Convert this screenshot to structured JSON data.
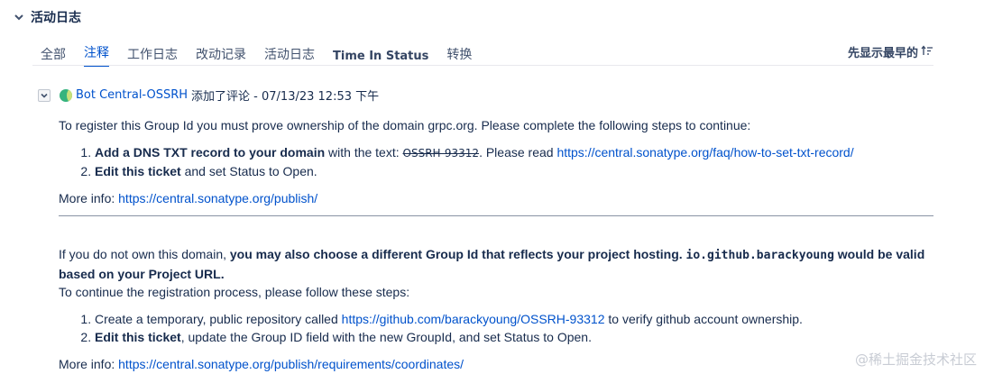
{
  "section": {
    "title": "活动日志"
  },
  "tabs": [
    "全部",
    "注释",
    "工作日志",
    "改动记录",
    "活动日志",
    "Time In Status",
    "转换"
  ],
  "active_tab": "注释",
  "sort_label": "先显示最早的",
  "comment": {
    "author": "Bot Central-OSSRH",
    "meta": "添加了评论 - 07/13/23 12:53 下午",
    "intro": "To register this Group Id you must prove ownership of the domain grpc.org. Please complete the following steps to continue:",
    "step1_bold": "Add a DNS TXT record to your domain",
    "step1_text": " with the text: ",
    "step1_code": "OSSRH-93312",
    "step1_after": ". Please read ",
    "step1_link": "https://central.sonatype.org/faq/how-to-set-txt-record/",
    "step2_bold": "Edit this ticket",
    "step2_text": " and set Status to Open.",
    "more_info_label": "More info: ",
    "more_info_link": "https://central.sonatype.org/publish/",
    "alt_intro": "If you do not own this domain, ",
    "alt_bold_a": "you may also choose a different Group Id that reflects your project hosting. ",
    "alt_mono": "io.github.barackyoung",
    "alt_bold_b": " would be valid based on your Project URL.",
    "continue_text": "To continue the registration process, please follow these steps:",
    "alt_step1_text": "Create a temporary, public repository called ",
    "alt_step1_link": "https://github.com/barackyoung/OSSRH-93312",
    "alt_step1_after": " to verify github account ownership.",
    "alt_step2_bold": "Edit this ticket",
    "alt_step2_text": ", update the Group ID field with the new GroupId, and set Status to Open.",
    "more_info2_label": "More info: ",
    "more_info2_link": "https://central.sonatype.org/publish/requirements/coordinates/"
  },
  "watermark": "@稀土掘金技术社区",
  "colors": {
    "link": "#0052cc",
    "text": "#172b4d",
    "tab_active": "#0052cc",
    "avatar": "#36b37e"
  }
}
